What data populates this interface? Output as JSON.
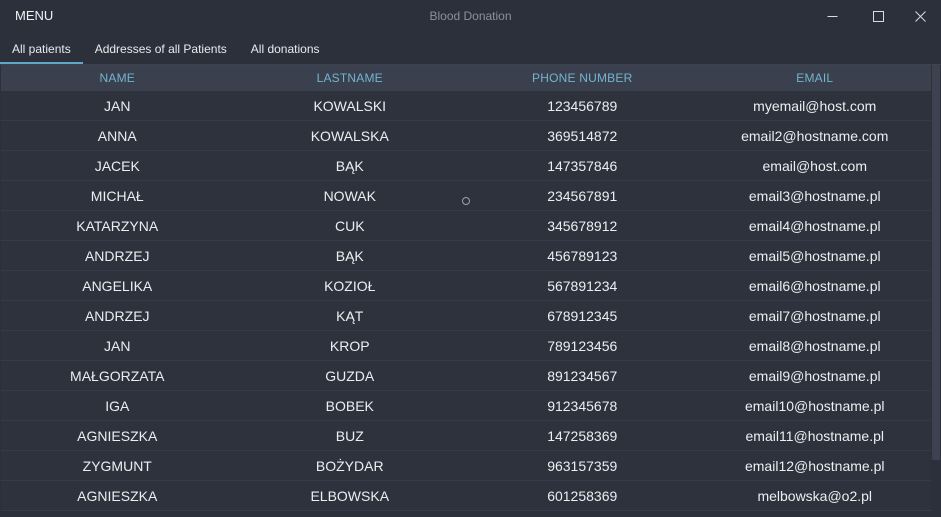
{
  "titlebar": {
    "menu_label": "MENU",
    "app_title": "Blood Donation"
  },
  "tabs": [
    {
      "label": "All patients",
      "active": true
    },
    {
      "label": "Addresses of all Patients",
      "active": false
    },
    {
      "label": "All donations",
      "active": false
    }
  ],
  "table": {
    "columns": [
      "NAME",
      "LASTNAME",
      "PHONE NUMBER",
      "EMAIL"
    ],
    "rows": [
      [
        "JAN",
        "KOWALSKI",
        "123456789",
        "myemail@host.com"
      ],
      [
        "ANNA",
        "KOWALSKA",
        "369514872",
        "email2@hostname.com"
      ],
      [
        "JACEK",
        "BĄK",
        "147357846",
        "email@host.com"
      ],
      [
        "MICHAŁ",
        "NOWAK",
        "234567891",
        "email3@hostname.pl"
      ],
      [
        "KATARZYNA",
        "CUK",
        "345678912",
        "email4@hostname.pl"
      ],
      [
        "ANDRZEJ",
        "BĄK",
        "456789123",
        "email5@hostname.pl"
      ],
      [
        "ANGELIKA",
        "KOZIOŁ",
        "567891234",
        "email6@hostname.pl"
      ],
      [
        "ANDRZEJ",
        "KĄT",
        "678912345",
        "email7@hostname.pl"
      ],
      [
        "JAN",
        "KROP",
        "789123456",
        "email8@hostname.pl"
      ],
      [
        "MAŁGORZATA",
        "GUZDA",
        "891234567",
        "email9@hostname.pl"
      ],
      [
        "IGA",
        "BOBEK",
        "912345678",
        "email10@hostname.pl"
      ],
      [
        "AGNIESZKA",
        "BUZ",
        "147258369",
        "email11@hostname.pl"
      ],
      [
        "ZYGMUNT",
        "BOŻYDAR",
        "963157359",
        "email12@hostname.pl"
      ],
      [
        "AGNIESZKA",
        "ELBOWSKA",
        "601258369",
        "melbowska@o2.pl"
      ]
    ]
  },
  "colors": {
    "background": "#2b303b",
    "header_background": "#3a404d",
    "accent": "#5fa8c8",
    "header_text": "#74b4d0"
  },
  "icons": {
    "minimize": "minimize-icon",
    "maximize": "maximize-icon",
    "close": "close-icon"
  }
}
